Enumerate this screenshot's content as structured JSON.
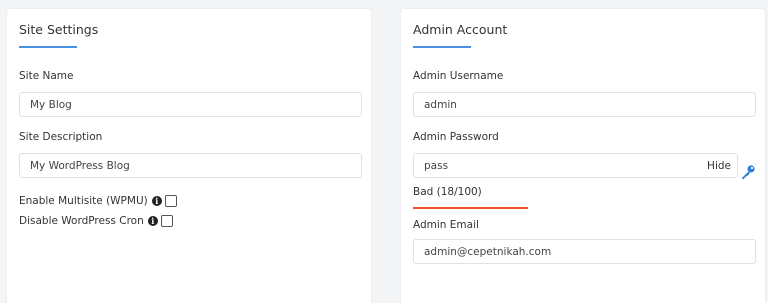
{
  "site_settings": {
    "title": "Site Settings",
    "site_name_label": "Site Name",
    "site_name_value": "My Blog",
    "site_description_label": "Site Description",
    "site_description_value": "My WordPress Blog",
    "multisite_label": "Enable Multisite (WPMU)",
    "cron_label": "Disable WordPress Cron",
    "multisite_checked": false,
    "cron_checked": false
  },
  "admin_account": {
    "title": "Admin Account",
    "username_label": "Admin Username",
    "username_value": "admin",
    "password_label": "Admin Password",
    "password_value": "pass",
    "hide_label": "Hide",
    "strength_text": "Bad (18/100)",
    "strength_level": 0.18,
    "email_label": "Admin Email",
    "email_value": "admin@cepetnikah.com"
  },
  "colors": {
    "accent": "#4a90e2",
    "strength_bad": "#f2522e",
    "key_icon": "#2f7fd8"
  },
  "icons": {
    "info": "info-icon",
    "key": "key-icon"
  }
}
